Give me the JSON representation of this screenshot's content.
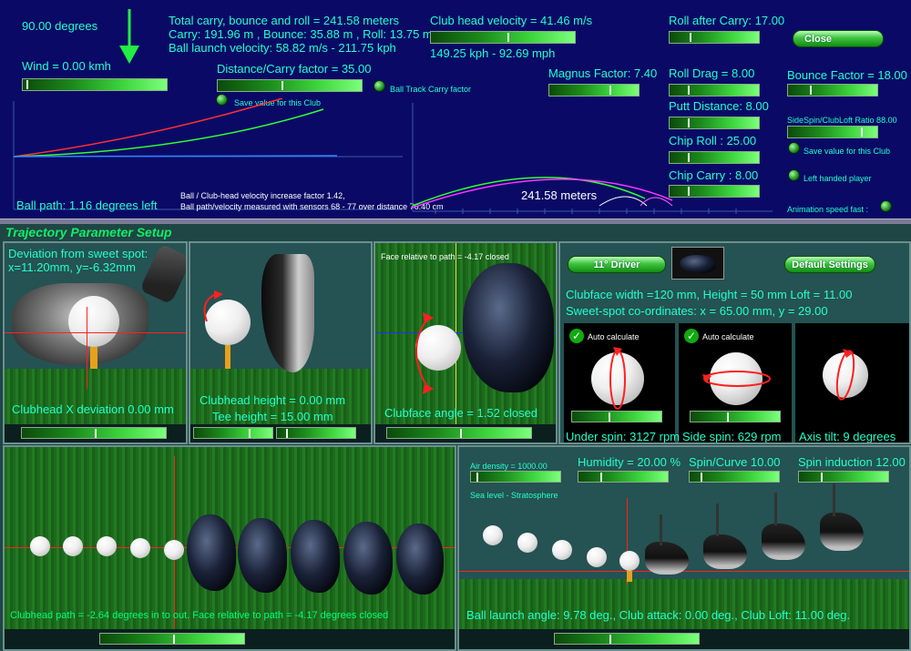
{
  "top": {
    "degrees": "90.00 degrees",
    "wind": "Wind = 0.00 kmh",
    "total_carry": "Total carry, bounce and roll = 241.58 meters",
    "carry_line": "Carry: 191.96 m , Bounce: 35.88 m , Roll: 13.75 m",
    "launch_velocity": "Ball launch velocity: 58.82 m/s - 211.75 kph",
    "distance_factor": "Distance/Carry factor = 35.00",
    "save_club": "Save value for this Club",
    "ball_track": "Ball Track Carry factor",
    "club_velocity": "Club head velocity = 41.46 m/s",
    "kph_mph": "149.25 kph  - 92.69 mph",
    "magnus": "Magnus Factor: 7.40",
    "roll_after": "Roll after Carry: 17.00",
    "roll_drag": "Roll Drag = 8.00",
    "putt_distance": "Putt Distance: 8.00",
    "chip_roll": "Chip Roll : 25.00",
    "chip_carry": "Chip Carry : 8.00",
    "close": "Close",
    "bounce_factor": "Bounce Factor = 18.00",
    "sidespin_ratio": "SideSpin/ClubLoft Ratio 88.00",
    "save_club2": "Save value for this Club",
    "left_handed": "Left handed player",
    "animation_speed": "Animation speed fast :",
    "ball_path": "Ball path: 1.16 degrees left",
    "velocity_factor": "Ball / Club-head velocity increase factor 1.42,",
    "sensors": "Ball path/velocity measured with sensors 68 - 77 over distance 76.40 cm",
    "meters_label": "241.58 meters"
  },
  "setup_title": "Trajectory Parameter Setup",
  "panel1": {
    "deviation": "Deviation from sweet spot:",
    "xy": "x=11.20mm,  y=-6.32mm",
    "x_dev": "Clubhead X deviation 0.00 mm"
  },
  "panel2": {
    "height": "Clubhead height = 0.00 mm",
    "tee": "Tee height = 15.00 mm"
  },
  "panel3": {
    "face_rel": "Face relative to path = -4.17 closed",
    "angle": "Clubface angle = 1.52 closed"
  },
  "panel4": {
    "driver": "11° Driver",
    "default": "Default Settings",
    "clubface": "Clubface width =120 mm,  Height = 50 mm    Loft = 11.00",
    "sweetspot": "Sweet-spot co-ordinates: x = 65.00 mm,  y = 29.00",
    "auto1": "Auto calculate",
    "auto2": "Auto calculate",
    "under_spin": "Under spin: 3127 rpm",
    "side_spin": "Side spin: 629 rpm",
    "axis_tilt": "Axis tilt: 9 degrees"
  },
  "panel5": {
    "path": "Clubhead path = -2.64 degrees in to out. Face relative to path = -4.17 degrees closed"
  },
  "panel6": {
    "air_density": "Air density = 1000.00",
    "sea_level": "Sea level  -  Stratosphere",
    "humidity": "Humidity = 20.00 %",
    "spin_curve": "Spin/Curve 10.00",
    "spin_induction": "Spin induction 12.00",
    "launch": "Ball launch angle: 9.78 deg., Club attack: 0.00 deg., Club Loft: 11.00 deg."
  },
  "colors": {
    "panel_bg": "#0a0a66",
    "label": "#00ff7a",
    "grass": "#237a23"
  }
}
